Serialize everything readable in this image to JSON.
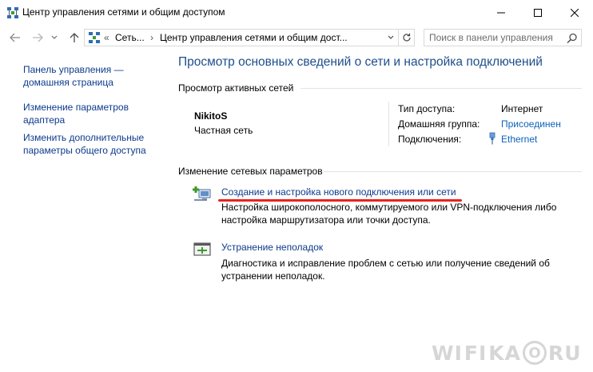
{
  "window": {
    "title": "Центр управления сетями и общим доступом"
  },
  "address_bar": {
    "overflow": "«",
    "crumb_1": "Сеть...",
    "crumb_2": "Центр управления сетями и общим дост...",
    "separator": "›"
  },
  "search": {
    "placeholder": "Поиск в панели управления"
  },
  "sidebar": {
    "items": [
      {
        "label": "Панель управления — домашняя страница"
      },
      {
        "label": "Изменение параметров адаптера"
      },
      {
        "label": "Изменить дополнительные параметры общего доступа"
      }
    ]
  },
  "main": {
    "heading": "Просмотр основных сведений о сети и настройка подключений",
    "active_networks_title": "Просмотр активных сетей",
    "network": {
      "name": "NikitoS",
      "type": "Частная сеть",
      "access_label": "Тип доступа:",
      "access_value": "Интернет",
      "homegroup_label": "Домашняя группа:",
      "homegroup_value": "Присоединен",
      "connections_label": "Подключения:",
      "connections_value": "Ethernet"
    },
    "change_settings_title": "Изменение сетевых параметров",
    "tasks": [
      {
        "link": "Создание и настройка нового подключения или сети",
        "description": "Настройка широкополосного, коммутируемого или VPN-подключения либо настройка маршрутизатора или точки доступа."
      },
      {
        "link": "Устранение неполадок",
        "description": "Диагностика и исправление проблем с сетью или получение сведений об устранении неполадок."
      }
    ]
  },
  "watermark": {
    "left": "WI",
    "mid": "FI",
    "right": "KA",
    "ring": "O",
    "tld": "RU"
  },
  "colors": {
    "heading": "#1e4e8c",
    "link": "#0d62b9",
    "nav_link": "#0d3a8c",
    "annotation_underline": "#e8231c"
  }
}
